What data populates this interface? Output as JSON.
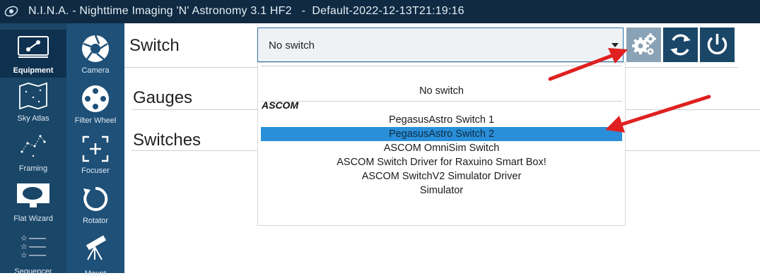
{
  "window": {
    "title": "N.I.N.A. - Nighttime Imaging 'N' Astronomy 3.1 HF2   -  Default-2022-12-13T21:19:16"
  },
  "sidebar_primary": {
    "items": [
      {
        "label": "Equipment",
        "icon": "plug-icon",
        "active": true
      },
      {
        "label": "Sky Atlas",
        "icon": "star-map-icon"
      },
      {
        "label": "Framing",
        "icon": "constellation-icon"
      },
      {
        "label": "Flat Wizard",
        "icon": "flat-panel-icon"
      },
      {
        "label": "Sequencer",
        "icon": "sequence-list-icon"
      }
    ]
  },
  "sidebar_secondary": {
    "items": [
      {
        "label": "Camera",
        "icon": "camera-aperture-icon"
      },
      {
        "label": "Filter Wheel",
        "icon": "filter-wheel-icon"
      },
      {
        "label": "Focuser",
        "icon": "focuser-icon"
      },
      {
        "label": "Rotator",
        "icon": "rotator-icon"
      },
      {
        "label": "Mount",
        "icon": "telescope-icon"
      }
    ]
  },
  "main": {
    "switch_label": "Switch",
    "gauges_label": "Gauges",
    "switches_label": "Switches",
    "selector": {
      "value": "No switch"
    },
    "buttons": {
      "settings_icon": "gear-icon",
      "refresh_icon": "refresh-icon",
      "power_icon": "power-icon"
    }
  },
  "dropdown": {
    "none_option": "No switch",
    "group_label": "ASCOM",
    "options": [
      "PegasusAstro Switch 1",
      "PegasusAstro Switch 2",
      "ASCOM OmniSim Switch",
      "ASCOM Switch Driver for Raxuino Smart Box!",
      "ASCOM SwitchV2 Simulator Driver",
      "Simulator"
    ],
    "selected_option": "PegasusAstro Switch 2"
  },
  "colors": {
    "titlebar": "#0f2a42",
    "sidebar": "#1a4668",
    "accent": "#2a8fd8",
    "annotation_arrow": "#e02020"
  }
}
